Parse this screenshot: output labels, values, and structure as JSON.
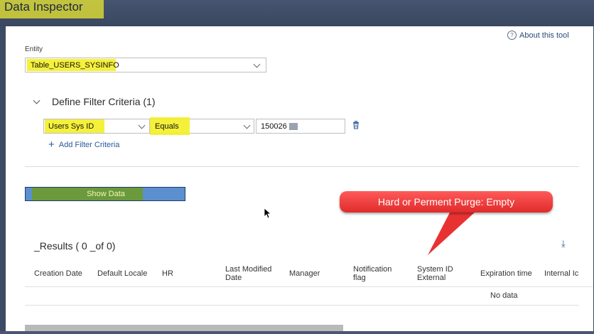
{
  "window": {
    "title": "Data Inspector"
  },
  "header": {
    "about_label": "About this tool",
    "about_icon": "question-circle-icon"
  },
  "entity": {
    "label": "Entity",
    "value": "Table_USERS_SYSINFO"
  },
  "filter": {
    "section_title": "Define Filter Criteria (1)",
    "field": "Users Sys ID",
    "operator": "Equals",
    "value": "150026",
    "add_label": "Add Filter Criteria"
  },
  "actions": {
    "show_data_label": "Show Data"
  },
  "annotation": {
    "text": "Hard or Perment Purge: Empty",
    "color": "#e83232"
  },
  "results": {
    "title": "_Results ( 0 _of 0)",
    "columns": [
      "Creation Date",
      "Default Locale",
      "HR",
      "Last Modified Date",
      "Manager",
      "Notification flag",
      "System ID External",
      "Expiration time",
      "Internal Ic"
    ],
    "empty_text": "No data"
  },
  "colors": {
    "highlight": "#f4f026",
    "accent": "#2a5a98",
    "frame": "#3d4a63"
  }
}
